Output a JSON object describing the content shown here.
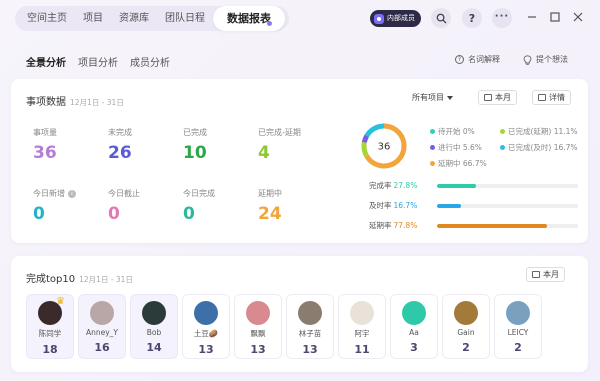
{
  "nav": {
    "tabs": [
      "空间主页",
      "项目",
      "资源库",
      "团队日程"
    ],
    "active_tab": "数据报表",
    "member_badge": "内部成员",
    "search_icon": "search-icon",
    "help_icon": "help-icon",
    "more_icon": "more-icon",
    "window_controls": [
      "minimize-icon",
      "maximize-icon",
      "close-icon"
    ]
  },
  "subnav": {
    "tabs": [
      "全景分析",
      "项目分析",
      "成员分析"
    ],
    "active": "全景分析",
    "glossary": "名词解释",
    "feedback": "提个想法"
  },
  "overview": {
    "title": "事项数据",
    "date_range": "12月1日 - 31日",
    "project_filter": "所有项目",
    "period": "本月",
    "details": "详情",
    "stats": [
      {
        "label": "事项量",
        "value": "36",
        "color": "#b57bd6"
      },
      {
        "label": "未完成",
        "value": "26",
        "color": "#5a5bd8"
      },
      {
        "label": "已完成",
        "value": "10",
        "color": "#2aa84a"
      },
      {
        "label": "已完成-延期",
        "value": "4",
        "color": "#8fc733"
      },
      {
        "label": "今日新增",
        "value": "0",
        "color": "#23b3c7"
      },
      {
        "label": "今日截止",
        "value": "0",
        "color": "#e07ab2"
      },
      {
        "label": "今日完成",
        "value": "0",
        "color": "#2eb89b"
      },
      {
        "label": "延期中",
        "value": "24",
        "color": "#f0a63a"
      }
    ],
    "donut_total": "36",
    "legend": [
      {
        "label": "待开始 0%",
        "color": "#2fd0b5"
      },
      {
        "label": "已完成(延期) 11.1%",
        "color": "#a8d435"
      },
      {
        "label": "进行中 5.6%",
        "color": "#7a5ae8"
      },
      {
        "label": "已完成(及时) 16.7%",
        "color": "#27c0de"
      },
      {
        "label": "延期中 66.7%",
        "color": "#f3a53b"
      }
    ],
    "donut_segments": [
      {
        "name": "延期中",
        "value": 66.7,
        "color": "#f3a53b"
      },
      {
        "name": "已完成(延期)",
        "value": 11.1,
        "color": "#a8d435"
      },
      {
        "name": "进行中",
        "value": 5.6,
        "color": "#7a5ae8"
      },
      {
        "name": "已完成(及时)",
        "value": 16.7,
        "color": "#27c0de"
      }
    ],
    "rates": [
      {
        "label": "完成率",
        "value": "27.8%",
        "pct": 27.8,
        "color": "#2dcba8"
      },
      {
        "label": "及时率",
        "value": "16.7%",
        "pct": 16.7,
        "color": "#27a7e8"
      },
      {
        "label": "延期率",
        "value": "77.8%",
        "pct": 77.8,
        "color": "#e0891f"
      }
    ]
  },
  "top10": {
    "title": "完成top10",
    "date_range": "12月1日 - 31日",
    "period": "本月",
    "people": [
      {
        "name": "陈同学",
        "count": "18",
        "color": "#3a2a2a"
      },
      {
        "name": "Anney_Y",
        "count": "16",
        "color": "#b9a7a7"
      },
      {
        "name": "Bob",
        "count": "14",
        "color": "#2b3b3a"
      },
      {
        "name": "土豆🥔",
        "count": "13",
        "color": "#3d6fa8"
      },
      {
        "name": "飘飘",
        "count": "13",
        "color": "#d88a8e"
      },
      {
        "name": "林子苗",
        "count": "13",
        "color": "#8a7d70"
      },
      {
        "name": "阿宇",
        "count": "11",
        "color": "#e8e2d8"
      },
      {
        "name": "Aa",
        "count": "3",
        "color": "#2ec9a8"
      },
      {
        "name": "Gain",
        "count": "2",
        "color": "#a47a3a"
      },
      {
        "name": "LEICY",
        "count": "2",
        "color": "#7aa0c0"
      }
    ]
  }
}
